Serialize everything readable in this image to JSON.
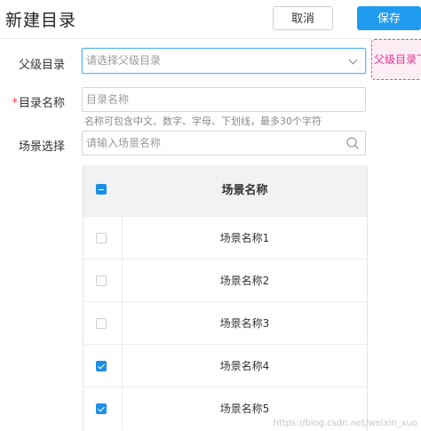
{
  "header": {
    "title": "新建目录",
    "cancel_label": "取消",
    "save_label": "保存"
  },
  "form": {
    "parent": {
      "label": "父级目录",
      "placeholder": "请选择父级目录",
      "tooltip": "父级目录下"
    },
    "name": {
      "required_mark": "*",
      "label": "目录名称",
      "placeholder": "目录名称",
      "hint": "名称可包含中文、数字、字母、下划线，最多30个字符"
    },
    "scene": {
      "label": "场景选择",
      "placeholder": "请输入场景名称"
    }
  },
  "table": {
    "header": "场景名称",
    "header_checkbox": "indeterminate",
    "rows": [
      {
        "name": "场景名称1",
        "checked": false
      },
      {
        "name": "场景名称2",
        "checked": false
      },
      {
        "name": "场景名称3",
        "checked": false
      },
      {
        "name": "场景名称4",
        "checked": true
      },
      {
        "name": "场景名称5",
        "checked": true
      }
    ]
  },
  "watermark": "https://blog.csdn.net/weixin_xuo"
}
